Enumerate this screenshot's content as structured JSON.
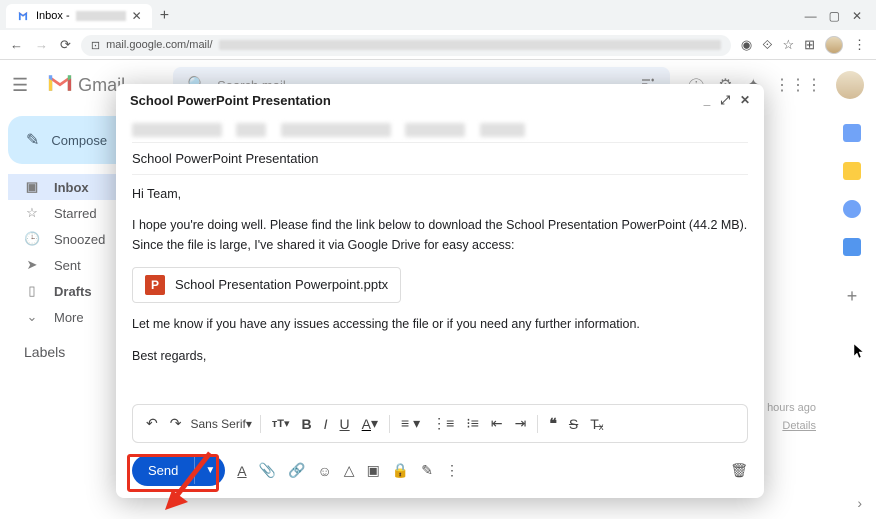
{
  "browser": {
    "tab_title": "Inbox -",
    "url_prefix": "mail.google.com/mail/"
  },
  "header": {
    "brand": "Gmail",
    "search_placeholder": "Search mail"
  },
  "sidebar": {
    "compose": "Compose",
    "items": [
      {
        "icon": "inbox",
        "label": "Inbox",
        "active": true
      },
      {
        "icon": "star",
        "label": "Starred",
        "active": false
      },
      {
        "icon": "clock",
        "label": "Snoozed",
        "active": false
      },
      {
        "icon": "send",
        "label": "Sent",
        "active": false
      },
      {
        "icon": "draft",
        "label": "Drafts",
        "active": false
      },
      {
        "icon": "more",
        "label": "More",
        "active": false
      }
    ],
    "labels_heading": "Labels"
  },
  "content": {
    "hours_ago": "hours ago",
    "details": "Details"
  },
  "compose": {
    "title": "School PowerPoint Presentation",
    "subject": "School PowerPoint Presentation",
    "body": {
      "greeting": "Hi Team,",
      "p1": "I hope you're doing well. Please find the link below to download the School Presentation PowerPoint (44.2 MB). Since the file is large, I've shared it via Google Drive for easy access:",
      "p2": "Let me know if you have any issues accessing the file or if you need any further information.",
      "signoff": "Best regards,"
    },
    "attachment": {
      "icon_letter": "P",
      "filename": "School Presentation Powerpoint.pptx"
    },
    "toolbar": {
      "font": "Sans Serif"
    },
    "send": "Send"
  }
}
